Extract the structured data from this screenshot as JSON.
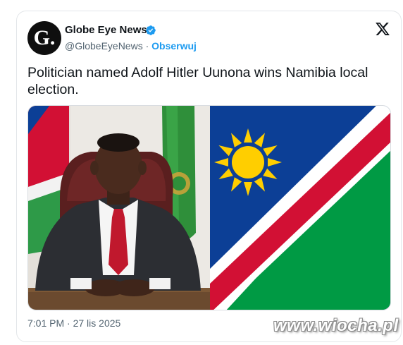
{
  "tweet": {
    "author_name": "Globe Eye News",
    "avatar_letter": "G.",
    "handle": "@GlobeEyeNews",
    "separator": "·",
    "follow_label": "Obserwuj",
    "text": "Politician named Adolf Hitler Uunona wins Namibia local election.",
    "timestamp": "7:01 PM · 27 lis 2025",
    "verified": true
  },
  "icons": {
    "verified": "verified-badge-icon",
    "platform": "x-logo-icon"
  },
  "colors": {
    "link_blue": "#1d9bf0",
    "text_primary": "#0f1419",
    "text_secondary": "#536471",
    "flag_blue": "#0c3f96",
    "flag_red": "#d21034",
    "flag_green": "#009a44",
    "flag_gold": "#ffce00"
  },
  "watermark": {
    "text": "www.wiocha.pl"
  }
}
